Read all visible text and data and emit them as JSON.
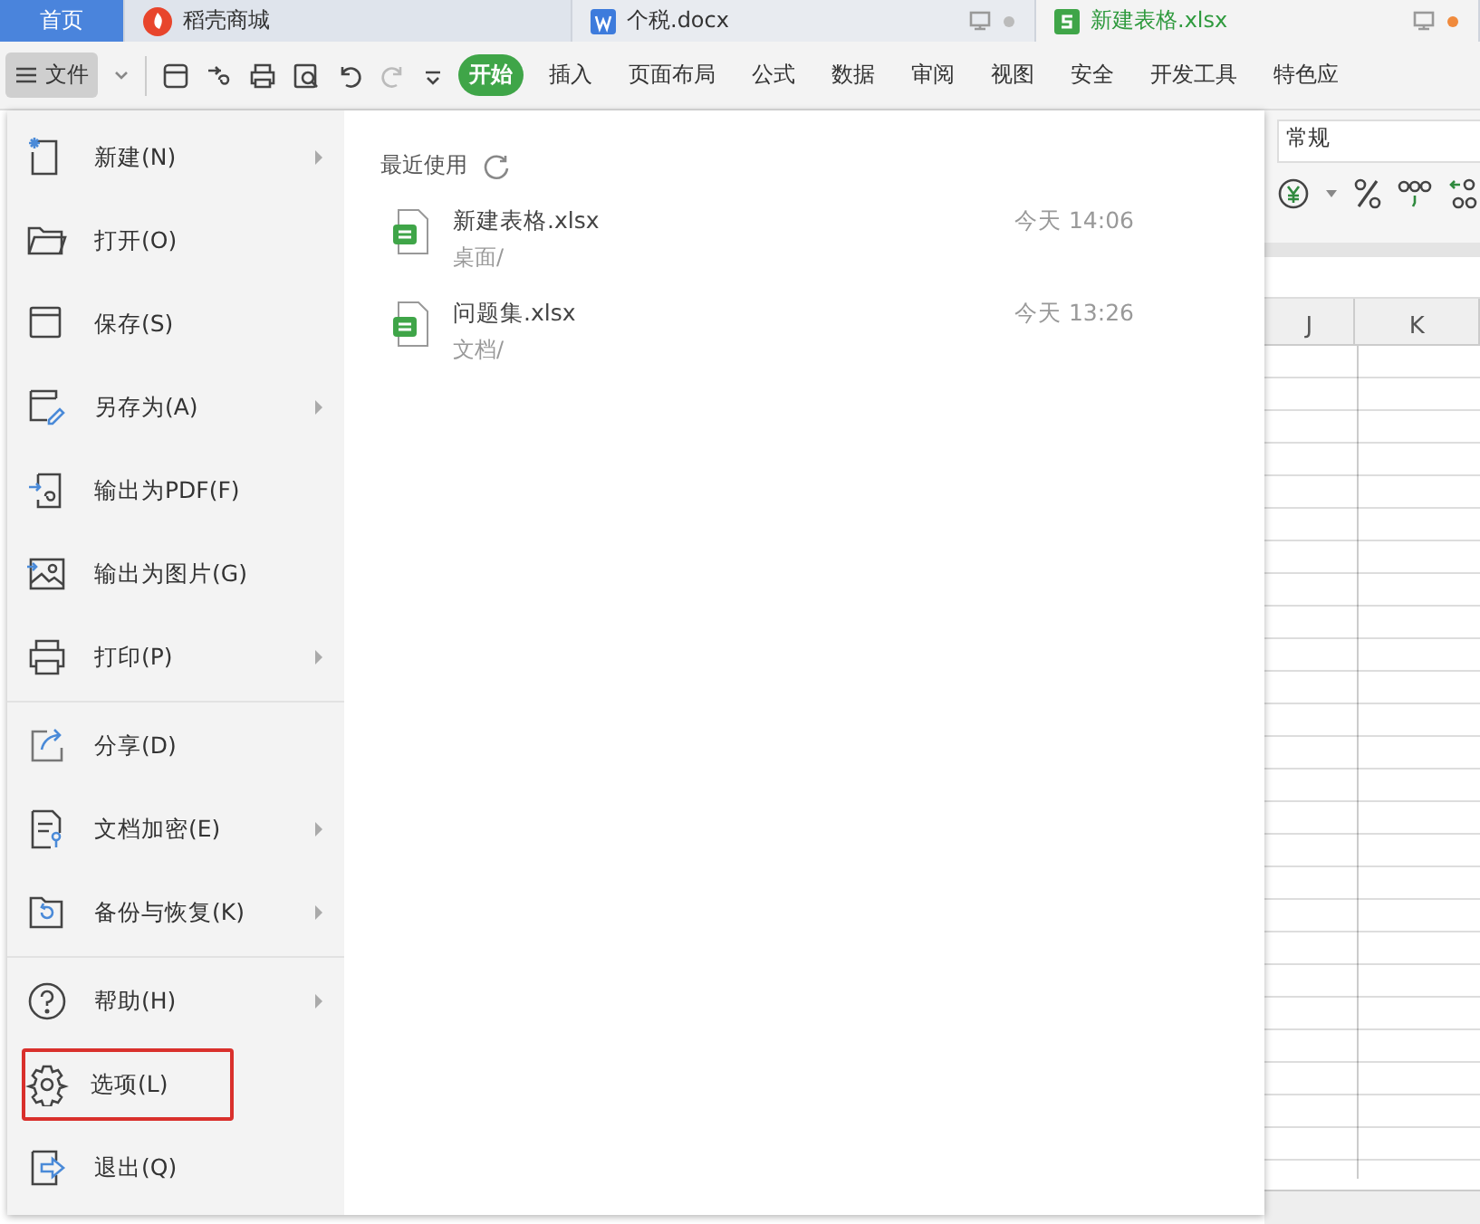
{
  "tabs": [
    {
      "label": "首页",
      "kind": "home",
      "selected": false
    },
    {
      "label": "稻壳商城",
      "kind": "store",
      "selected": false
    },
    {
      "label": "个税.docx",
      "kind": "doc",
      "selected": false
    },
    {
      "label": "新建表格.xlsx",
      "kind": "sheet",
      "selected": true
    }
  ],
  "toolbar": {
    "file_button": "文件",
    "ribbon_tabs": [
      {
        "label": "开始",
        "selected": true
      },
      {
        "label": "插入",
        "selected": false
      },
      {
        "label": "页面布局",
        "selected": false
      },
      {
        "label": "公式",
        "selected": false
      },
      {
        "label": "数据",
        "selected": false
      },
      {
        "label": "审阅",
        "selected": false
      },
      {
        "label": "视图",
        "selected": false
      },
      {
        "label": "安全",
        "selected": false
      },
      {
        "label": "开发工具",
        "selected": false
      },
      {
        "label": "特色应",
        "selected": false
      }
    ]
  },
  "file_menu": {
    "groups": [
      [
        {
          "label": "新建(N)",
          "submenu": true,
          "highlighted": false
        },
        {
          "label": "打开(O)",
          "submenu": false,
          "highlighted": false
        },
        {
          "label": "保存(S)",
          "submenu": false,
          "highlighted": false
        },
        {
          "label": "另存为(A)",
          "submenu": true,
          "highlighted": false
        },
        {
          "label": "输出为PDF(F)",
          "submenu": false,
          "highlighted": false
        },
        {
          "label": "输出为图片(G)",
          "submenu": false,
          "highlighted": false
        },
        {
          "label": "打印(P)",
          "submenu": true,
          "highlighted": false
        }
      ],
      [
        {
          "label": "分享(D)",
          "submenu": false,
          "highlighted": false
        },
        {
          "label": "文档加密(E)",
          "submenu": true,
          "highlighted": false
        },
        {
          "label": "备份与恢复(K)",
          "submenu": true,
          "highlighted": false
        }
      ],
      [
        {
          "label": "帮助(H)",
          "submenu": true,
          "highlighted": false
        },
        {
          "label": "选项(L)",
          "submenu": false,
          "highlighted": true
        },
        {
          "label": "退出(Q)",
          "submenu": false,
          "highlighted": false
        }
      ]
    ],
    "recent": {
      "title": "最近使用",
      "files": [
        {
          "name": "新建表格.xlsx",
          "path": "桌面/",
          "time": "今天 14:06"
        },
        {
          "name": "问题集.xlsx",
          "path": "文档/",
          "time": "今天 13:26"
        }
      ]
    }
  },
  "sheet": {
    "number_format": "常规",
    "columns": [
      "J",
      "K"
    ]
  }
}
